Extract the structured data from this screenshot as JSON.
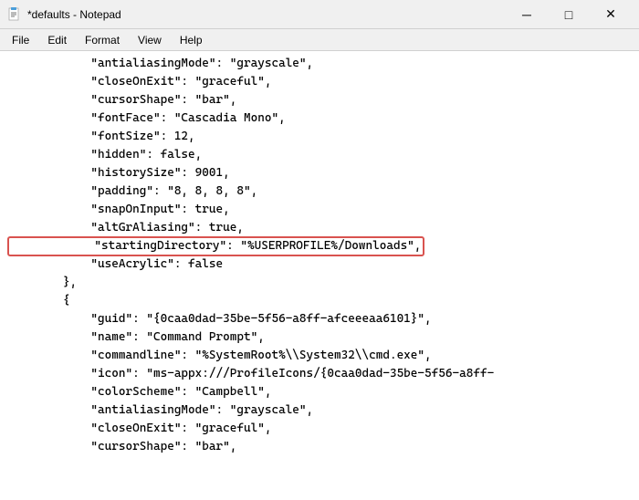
{
  "titleBar": {
    "icon": "📄",
    "title": "*defaults - Notepad",
    "minimizeLabel": "─",
    "maximizeLabel": "□",
    "closeLabel": "✕"
  },
  "menuBar": {
    "items": [
      "File",
      "Edit",
      "Format",
      "View",
      "Help"
    ]
  },
  "editor": {
    "lines": [
      "            \"antialiasingMode\": \"grayscale\",",
      "            \"closeOnExit\": \"graceful\",",
      "            \"cursorShape\": \"bar\",",
      "            \"fontFace\": \"Cascadia Mono\",",
      "            \"fontSize\": 12,",
      "            \"hidden\": false,",
      "            \"historySize\": 9001,",
      "            \"padding\": \"8, 8, 8, 8\",",
      "            \"snapOnInput\": true,",
      "            \"altGrAliasing\": true,",
      "HIGHLIGHTED",
      "            \"useAcrylic\": false",
      "        },",
      "        {",
      "            \"guid\": \"{0caa0dad-35be-5f56-a8ff-afceeeaa6101}\",",
      "            \"name\": \"Command Prompt\",",
      "            \"commandline\": \"%SystemRoot%\\\\System32\\\\cmd.exe\",",
      "            \"icon\": \"ms-appx:///ProfileIcons/{0caa0dad-35be-5f56-a8ff-",
      "            \"colorScheme\": \"Campbell\",",
      "            \"antialiasingMode\": \"grayscale\",",
      "            \"closeOnExit\": \"graceful\",",
      "            \"cursorShape\": \"bar\","
    ],
    "highlightedLine": "            \"startingDirectory\": \"%USERPROFILE%/Downloads\","
  }
}
